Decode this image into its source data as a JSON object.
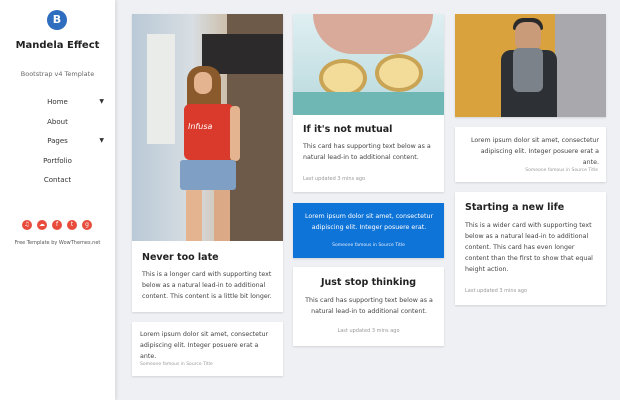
{
  "brand": {
    "logo_letter": "B",
    "name": "Mandela Effect",
    "tagline": "Bootstrap v4 Template"
  },
  "nav": [
    {
      "label": "Home",
      "has_dropdown": true
    },
    {
      "label": "About",
      "has_dropdown": false
    },
    {
      "label": "Pages",
      "has_dropdown": true
    },
    {
      "label": "Portfolio",
      "has_dropdown": false
    },
    {
      "label": "Contact",
      "has_dropdown": false
    }
  ],
  "social_icons": [
    "soundcloud-icon",
    "cloud-icon",
    "facebook-icon",
    "twitter-icon",
    "google-plus-icon"
  ],
  "credit": "Free Template by WowThemes.net",
  "cards": {
    "never_too_late": {
      "title": "Never too late",
      "text": "This is a longer card with supporting text below as a natural lead-in to additional content. This content is a little bit longer."
    },
    "quote_left": {
      "text": "Lorem ipsum dolor sit amet, consectetur adipiscing elit. Integer posuere erat a ante.",
      "footer": "Someone famous in Source Title"
    },
    "if_its_not_mutual": {
      "title": "If it's not mutual",
      "text": "This card has supporting text below as a natural lead-in to additional content.",
      "meta": "Last updated 3 mins ago"
    },
    "quote_blue": {
      "text": "Lorem ipsum dolor sit amet, consectetur adipiscing elit. Integer posuere erat.",
      "footer": "Someone famous in Source Title"
    },
    "just_stop_thinking": {
      "title": "Just stop thinking",
      "text": "This card has supporting text below as a natural lead-in to additional content.",
      "meta": "Last updated 3 mins ago"
    },
    "quote_right": {
      "text": "Lorem ipsum dolor sit amet, consectetur adipiscing elit. Integer posuere erat a ante.",
      "footer": "Someone famous in Source Title"
    },
    "starting_a_new_life": {
      "title": "Starting a new life",
      "text": "This is a wider card with supporting text below as a natural lead-in to additional content. This card has even longer content than the first to show that equal height action.",
      "meta": "Last updated 3 mins ago"
    }
  },
  "photo_overlay_text": "Infusa",
  "colors": {
    "accent_blue": "#0f74d8",
    "social_red": "#e74c3c",
    "logo_blue": "#2f6dbf"
  }
}
